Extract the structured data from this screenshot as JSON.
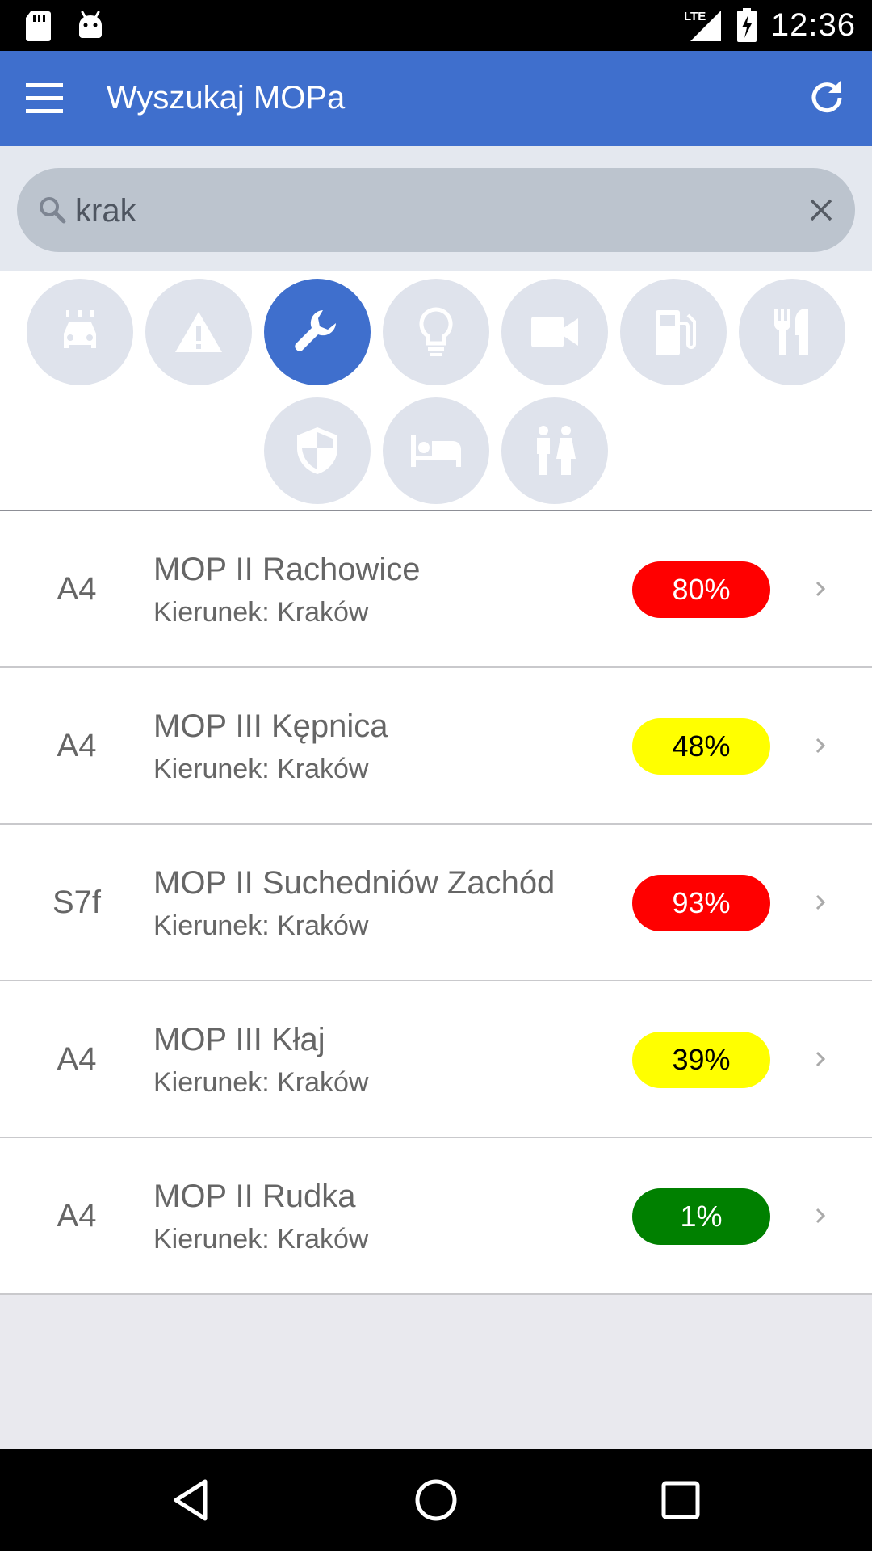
{
  "status_bar": {
    "time": "12:36",
    "network": "LTE",
    "left_icons": [
      "sd-card-icon",
      "android-icon"
    ],
    "right_icons": [
      "lte-signal-icon",
      "battery-charging-icon"
    ]
  },
  "app_bar": {
    "title": "Wyszukaj MOPa",
    "background": "#3f6fcd"
  },
  "search": {
    "value": "krak"
  },
  "filters": [
    {
      "icon": "car-wash-icon",
      "active": false
    },
    {
      "icon": "warning-icon",
      "active": false
    },
    {
      "icon": "wrench-icon",
      "active": true
    },
    {
      "icon": "lightbulb-icon",
      "active": false
    },
    {
      "icon": "video-camera-icon",
      "active": false
    },
    {
      "icon": "fuel-pump-icon",
      "active": false
    },
    {
      "icon": "restaurant-icon",
      "active": false
    },
    {
      "icon": "security-shield-icon",
      "active": false
    },
    {
      "icon": "bed-icon",
      "active": false
    },
    {
      "icon": "toilet-icon",
      "active": false
    }
  ],
  "results": [
    {
      "road": "A4",
      "name": "MOP II Rachowice",
      "direction": "Kierunek: Kraków",
      "occupancy": "80%",
      "badge_color": "#ff0000",
      "badge_text_color": "#ffffff"
    },
    {
      "road": "A4",
      "name": "MOP III Kępnica",
      "direction": "Kierunek: Kraków",
      "occupancy": "48%",
      "badge_color": "#ffff00",
      "badge_text_color": "#000000"
    },
    {
      "road": "S7f",
      "name": "MOP II Suchedniów Zachód",
      "direction": "Kierunek: Kraków",
      "occupancy": "93%",
      "badge_color": "#ff0000",
      "badge_text_color": "#ffffff"
    },
    {
      "road": "A4",
      "name": "MOP III Kłaj",
      "direction": "Kierunek: Kraków",
      "occupancy": "39%",
      "badge_color": "#ffff00",
      "badge_text_color": "#000000"
    },
    {
      "road": "A4",
      "name": "MOP II Rudka",
      "direction": "Kierunek: Kraków",
      "occupancy": "1%",
      "badge_color": "#008000",
      "badge_text_color": "#ffffff"
    }
  ],
  "nav_bar": {
    "buttons": [
      "back-icon",
      "home-icon",
      "recents-icon"
    ]
  }
}
